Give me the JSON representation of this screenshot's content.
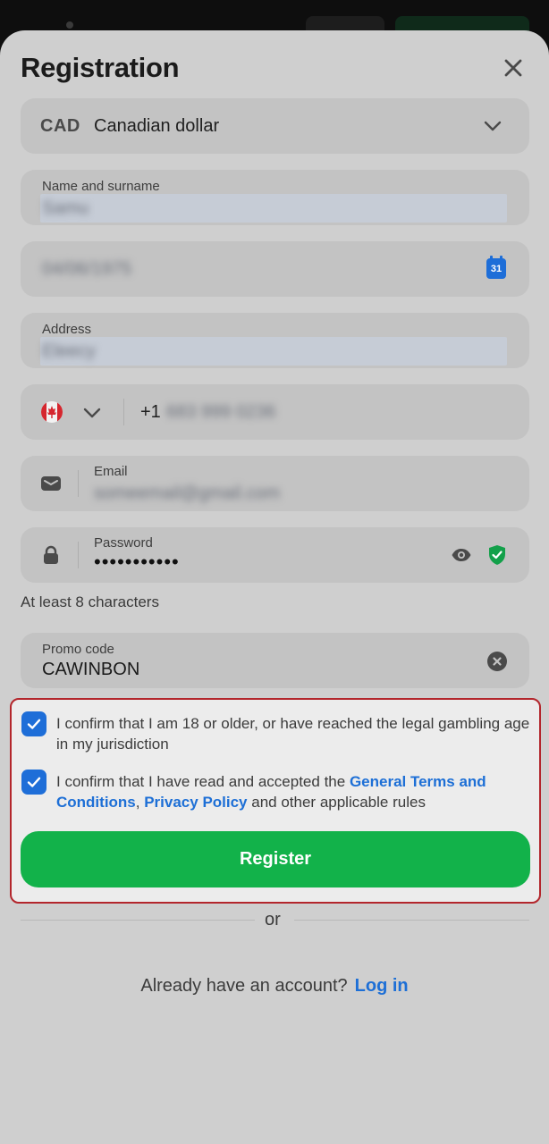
{
  "sheet": {
    "title": "Registration"
  },
  "currency": {
    "code": "CAD",
    "name": "Canadian dollar"
  },
  "name_field": {
    "label": "Name and surname",
    "value": "Samu"
  },
  "birthdate_field": {
    "value": "04/06/1975",
    "calendar_day": "31"
  },
  "address_field": {
    "label": "Address",
    "value": "Eleecy"
  },
  "phone_field": {
    "prefix": "+1",
    "value": "683 999 0236"
  },
  "email_field": {
    "label": "Email",
    "value": "someemail@gmail.com"
  },
  "password_field": {
    "label": "Password",
    "value": "•••••••••••",
    "hint": "At least 8 characters"
  },
  "promo_field": {
    "label": "Promo code",
    "value": "CAWINBON"
  },
  "consent": {
    "age_text": "I confirm that I am 18 or older, or have reached the legal gambling age in my jurisdiction",
    "terms_prefix": "I confirm that I have read and accepted the ",
    "terms_link": "General Terms and Conditions",
    "terms_comma": ", ",
    "privacy_link": "Privacy Policy",
    "terms_suffix": " and other applicable rules",
    "register_label": "Register"
  },
  "divider": {
    "text": "or"
  },
  "login": {
    "prompt": "Already have an account?",
    "link": "Log in"
  },
  "colors": {
    "accent_blue": "#1d6fd6",
    "register_green": "#12b24a",
    "shield_green": "#13a04a",
    "highlight_red": "#b3262c"
  },
  "icons": [
    "close-icon",
    "chevron-down-icon",
    "calendar-icon",
    "canada-flag-icon",
    "envelope-icon",
    "lock-icon",
    "eye-icon",
    "shield-check-icon",
    "clear-icon",
    "checkmark-icon"
  ]
}
